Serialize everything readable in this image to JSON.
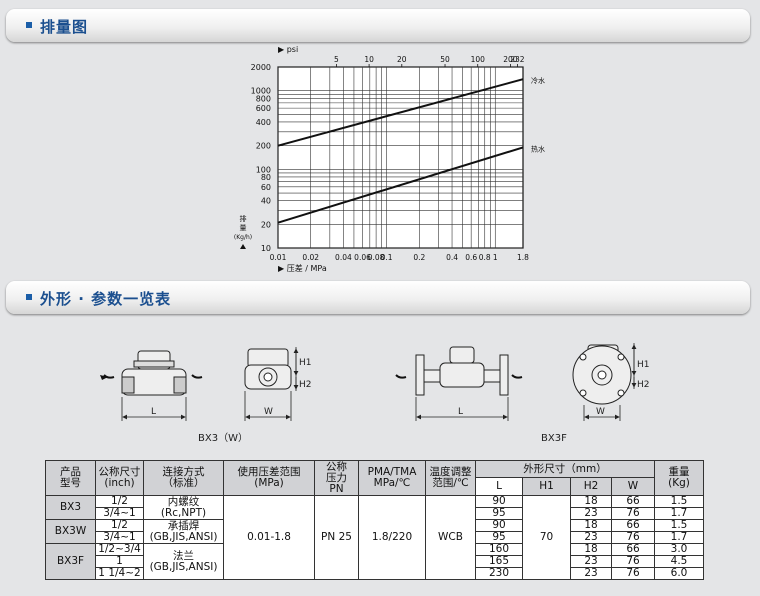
{
  "sections": {
    "discharge": "排量图",
    "dimensions": "外形 · 参数一览表"
  },
  "chart_data": {
    "type": "line",
    "title": "",
    "xlabel": "压差 / MPa",
    "x_top_label": "psi",
    "ylabel": "排量(Kg/h)",
    "x_scale": "log",
    "y_scale": "log",
    "xlim": [
      0.01,
      1.8
    ],
    "ylim": [
      10,
      2000
    ],
    "x_ticks": [
      "0.01",
      "0.02",
      "0.04",
      "0.06",
      "0.08",
      "0.1",
      "0.2",
      "0.4",
      "0.6",
      "0.8",
      "1",
      "1.8"
    ],
    "x_top_ticks": [
      "5",
      "10",
      "20",
      "50",
      "100",
      "200",
      "232"
    ],
    "y_ticks": [
      "2000",
      "1000",
      "800",
      "600",
      "400",
      "200",
      "100",
      "80",
      "60",
      "40",
      "20",
      "10"
    ],
    "series": [
      {
        "name": "冷水",
        "x": [
          0.01,
          1.8
        ],
        "y": [
          200,
          1400
        ]
      },
      {
        "name": "热水",
        "x": [
          0.01,
          1.8
        ],
        "y": [
          21,
          190
        ]
      }
    ]
  },
  "drawings": {
    "bx3_label": "BX3（W）",
    "bx3f_label": "BX3F",
    "dim_L": "L",
    "dim_W": "W",
    "dim_H1": "H1",
    "dim_H2": "H2"
  },
  "table": {
    "headers": {
      "model": [
        "产品",
        "型号"
      ],
      "size": [
        "公称尺寸",
        "(inch)"
      ],
      "conn": [
        "连接方式",
        "（标准）"
      ],
      "range": [
        "使用压差范围",
        "(MPa)"
      ],
      "pn": [
        "公称",
        "压力",
        "PN"
      ],
      "pma": [
        "PMA/TMA",
        "MPa/℃"
      ],
      "temp": [
        "温度调整",
        "范围/℃"
      ],
      "dims": "外形尺寸（mm）",
      "L": "L",
      "H1": "H1",
      "H2": "H2",
      "W": "W",
      "weight": [
        "重量",
        "(Kg)"
      ]
    },
    "models": [
      "BX3",
      "BX3W",
      "BX3F"
    ],
    "sizes": [
      "1/2",
      "3/4~1",
      "1/2",
      "3/4~1",
      "1/2~3/4",
      "1",
      "1 1/4~2"
    ],
    "connections": [
      [
        "内螺纹",
        "(Rc,NPT)"
      ],
      [
        "承插焊",
        "(GB,JIS,ANSI)"
      ],
      [
        "法兰",
        "(GB,JIS,ANSI)"
      ]
    ],
    "pressure_range": "0.01-1.8",
    "pn": "PN 25",
    "pma": "1.8/220",
    "temp": "WCB",
    "L": [
      "90",
      "95",
      "90",
      "95",
      "160",
      "165",
      "230"
    ],
    "H1": "70",
    "H2": [
      "18",
      "23",
      "18",
      "23",
      "18",
      "23",
      "23"
    ],
    "W": [
      "66",
      "76",
      "66",
      "76",
      "66",
      "76",
      "76"
    ],
    "weight": [
      "1.5",
      "1.7",
      "1.5",
      "1.7",
      "3.0",
      "4.5",
      "6.0"
    ]
  }
}
